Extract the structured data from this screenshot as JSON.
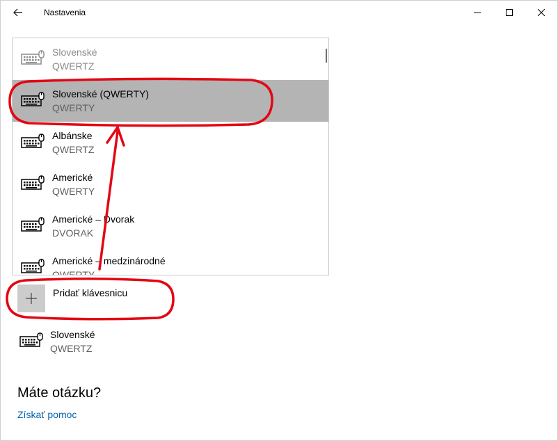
{
  "window": {
    "title": "Nastavenia",
    "back_icon": "arrow-left-icon",
    "minimize_icon": "minimize-icon",
    "maximize_icon": "maximize-icon",
    "close_icon": "close-icon"
  },
  "keyboard_list": {
    "items": [
      {
        "name": "Slovenské",
        "layout": "QWERTZ",
        "state": "disabled"
      },
      {
        "name": "Slovenské (QWERTY)",
        "layout": "QWERTY",
        "state": "selected"
      },
      {
        "name": "Albánske",
        "layout": "QWERTZ",
        "state": "normal"
      },
      {
        "name": "Americké",
        "layout": "QWERTY",
        "state": "normal"
      },
      {
        "name": "Americké – Dvorak",
        "layout": "DVORAK",
        "state": "normal"
      },
      {
        "name": "Americké – medzinárodné",
        "layout": "QWERTY",
        "state": "normal"
      }
    ]
  },
  "add_keyboard": {
    "label": "Pridať klávesnicu",
    "icon": "plus-icon"
  },
  "installed_keyboard": {
    "name": "Slovenské",
    "layout": "QWERTZ"
  },
  "help": {
    "question": "Máte otázku?",
    "link": "Získať pomoc"
  },
  "colors": {
    "selected_bg": "#b4b4b4",
    "link": "#0063b1",
    "annotation": "#e30613"
  }
}
